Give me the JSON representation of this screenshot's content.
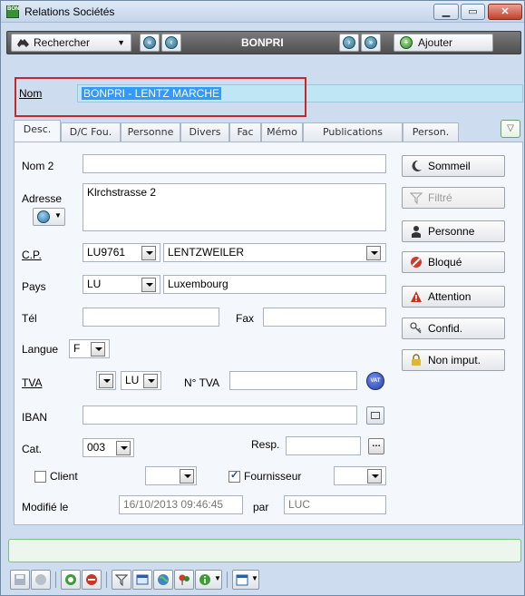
{
  "window": {
    "title": "Relations Sociétés",
    "icon_text": "BON"
  },
  "toolbar": {
    "search_label": "Rechercher",
    "center_label": "BONPRI",
    "add_label": "Ajouter"
  },
  "nom": {
    "label": "Nom",
    "value": "BONPRI - LENTZ MARCHE"
  },
  "tabs": [
    "Desc.",
    "D/C Fou.",
    "Personne",
    "Divers",
    "Fac",
    "Mémo",
    "Publications",
    "Person."
  ],
  "form": {
    "nom2_label": "Nom 2",
    "nom2_value": "",
    "adresse_label": "Adresse",
    "adresse_value": "Klrchstrasse 2",
    "cp_label": "C.P.",
    "cp_value": "LU9761",
    "city_value": "LENTZWEILER",
    "pays_label": "Pays",
    "pays_code": "LU",
    "pays_name": "Luxembourg",
    "tel_label": "Tél",
    "tel_value": "",
    "fax_label": "Fax",
    "fax_value": "",
    "langue_label": "Langue",
    "langue_value": "F",
    "tva_label": "TVA",
    "tva_country": "LU",
    "ntva_label": "N° TVA",
    "ntva_value": "",
    "vat_icon_text": "VAT",
    "iban_label": "IBAN",
    "iban_value": "",
    "cat_label": "Cat.",
    "cat_value": "003",
    "resp_label": "Resp.",
    "resp_value": "",
    "client_label": "Client",
    "client_checked": false,
    "fournisseur_label": "Fournisseur",
    "fournisseur_checked": true,
    "modifie_label": "Modifié le",
    "modifie_value": "16/10/2013 09:46:45",
    "par_label": "par",
    "par_value": "LUC"
  },
  "side_buttons": {
    "sommeil": "Sommeil",
    "filtre": "Filtré",
    "personne": "Personne",
    "bloque": "Bloqué",
    "attention": "Attention",
    "confid": "Confid.",
    "nonimput": "Non imput."
  },
  "colors": {
    "name_field_bg": "#bfe6f5",
    "highlight_border": "#c62828",
    "toolbar_bg": "#5f5f5f"
  }
}
